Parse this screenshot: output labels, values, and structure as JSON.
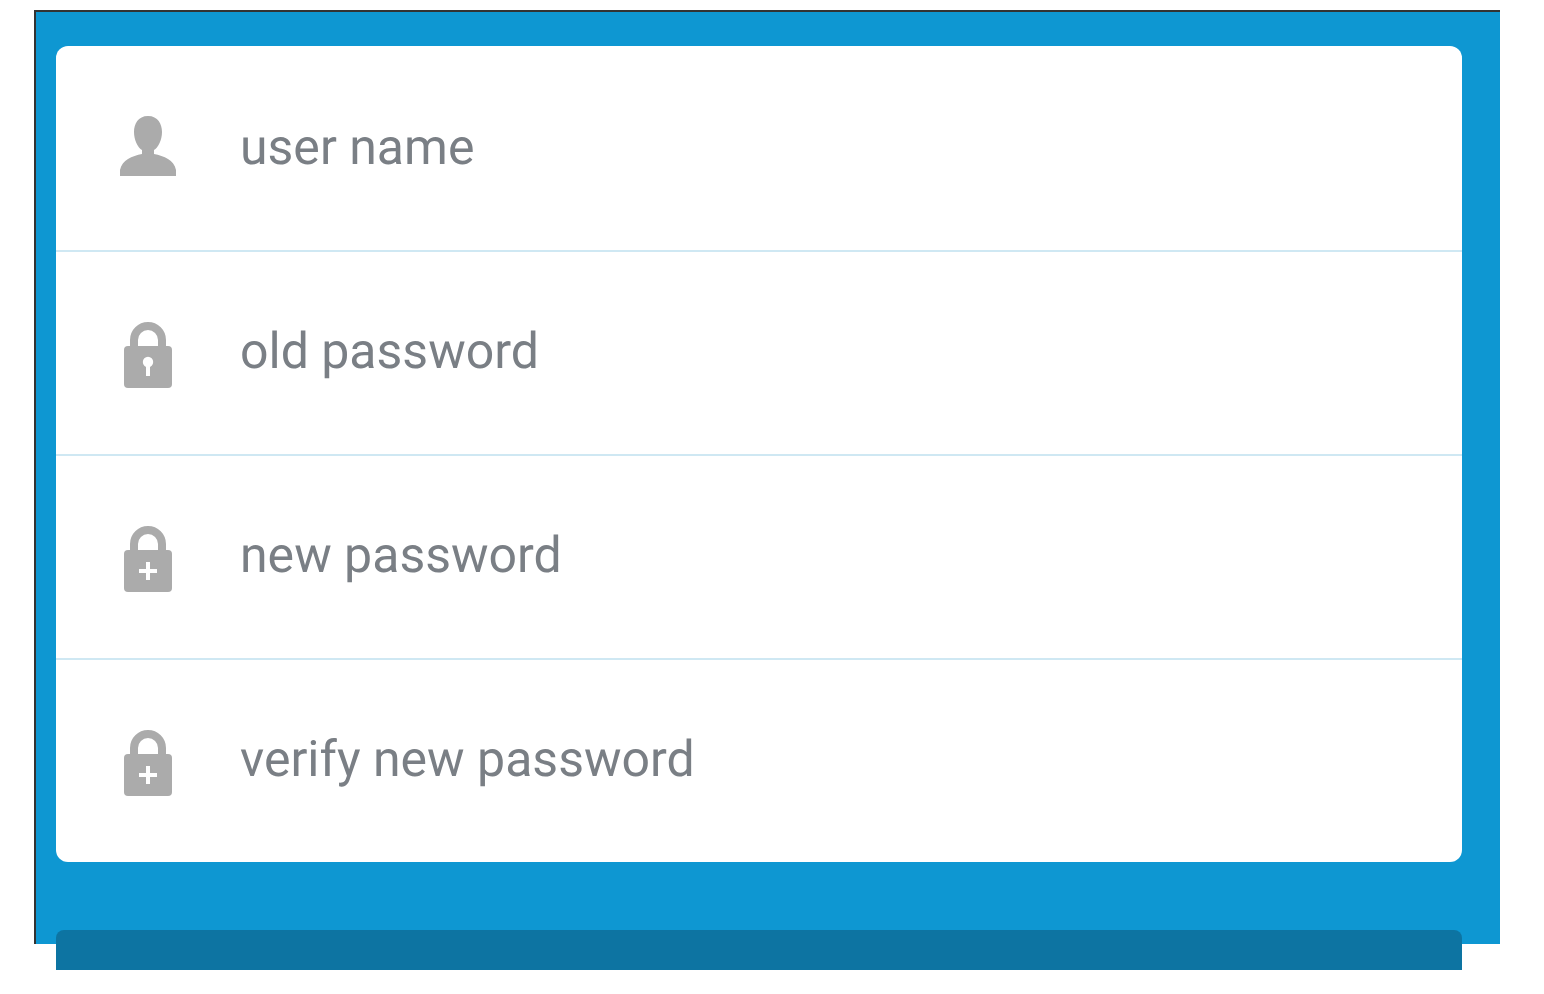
{
  "fields": [
    {
      "kind": "user",
      "placeholder": "user name"
    },
    {
      "kind": "lock-key",
      "placeholder": "old password"
    },
    {
      "kind": "lock-plus",
      "placeholder": "new password"
    },
    {
      "kind": "lock-plus",
      "placeholder": "verify new password"
    }
  ]
}
